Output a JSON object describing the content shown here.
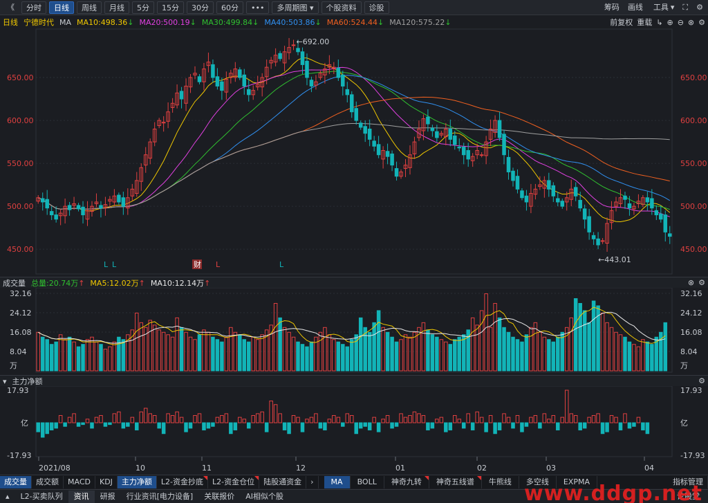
{
  "toolbar": {
    "back": "《",
    "periods": [
      "分时",
      "日线",
      "周线",
      "月线",
      "5分",
      "15分",
      "30分",
      "60分"
    ],
    "active_period": "日线",
    "more": "•••",
    "multi_period": "多周期图",
    "stock_info": "个股资料",
    "diagnose": "诊股",
    "right": [
      "筹码",
      "画线",
      "工具"
    ]
  },
  "main_legend": {
    "period": "日线",
    "stock": "宁德时代",
    "ma_label": "MA",
    "items": [
      {
        "label": "MA10:498.36",
        "dir": "↓",
        "color": "#f0c800"
      },
      {
        "label": "MA20:500.19",
        "dir": "↓",
        "color": "#e040e0"
      },
      {
        "label": "MA30:499.84",
        "dir": "↓",
        "color": "#30c030"
      },
      {
        "label": "MA40:503.86",
        "dir": "↓",
        "color": "#3090f0"
      },
      {
        "label": "MA60:524.44",
        "dir": "↓",
        "color": "#f06020"
      },
      {
        "label": "MA120:575.22",
        "dir": "↓",
        "color": "#a0a0a0"
      }
    ],
    "adjust": "前复权",
    "overlay": "重载"
  },
  "price_axis": [
    "650.00",
    "600.00",
    "550.00",
    "500.00",
    "450.00"
  ],
  "annotations": {
    "high": "692.00",
    "low": "443.01",
    "markers": [
      "L",
      "L",
      "财",
      "L",
      "L"
    ]
  },
  "volume_legend": {
    "title": "成交量",
    "total": "总量:20.74万",
    "ma5": "MA5:12.02万",
    "ma10": "MA10:12.14万",
    "arrow": "↑"
  },
  "volume_axis": [
    "32.16",
    "24.12",
    "16.08",
    "8.04",
    "万"
  ],
  "flow_legend": {
    "title": "主力净额"
  },
  "flow_axis": [
    "17.93",
    "亿",
    "-17.93"
  ],
  "x_axis": [
    "2021/08",
    "10",
    "11",
    "12",
    "01",
    "02",
    "03",
    "04"
  ],
  "indicator_tabs": [
    {
      "label": "成交量",
      "active": true
    },
    {
      "label": "成交额"
    },
    {
      "label": "MACD"
    },
    {
      "label": "KDJ"
    },
    {
      "label": "主力净额",
      "active": true
    },
    {
      "label": "L2-资金抄底",
      "flag": true
    },
    {
      "label": "L2-资金仓位",
      "flag": true
    },
    {
      "label": "陆股通资金"
    }
  ],
  "overlay_tabs": [
    {
      "label": "MA",
      "active": true
    },
    {
      "label": "BOLL"
    },
    {
      "label": "神奇九转",
      "flag": true
    },
    {
      "label": "神奇五线谱",
      "flag": true
    },
    {
      "label": "牛熊线"
    },
    {
      "label": "多空线"
    },
    {
      "label": "EXPMA"
    }
  ],
  "indicator_manage": "指标管理",
  "bottom_tabs": [
    "L2-买卖队列",
    "资讯",
    "研报",
    "行业资讯[电力设备]",
    "关联报价",
    "AI相似个股"
  ],
  "bottom_active": "资讯",
  "forum": "论股堂",
  "watermark": "www.ddgp.net",
  "colors": {
    "up": "#e04040",
    "down": "#12b4b8",
    "ma5": "#f0c800",
    "ma10vol": "#e8e8e8"
  },
  "chart_data": {
    "type": "candlestick",
    "ylim": [
      430,
      700
    ],
    "closes": [
      510,
      505,
      498,
      490,
      485,
      492,
      500,
      496,
      503,
      497,
      490,
      495,
      500,
      505,
      498,
      502,
      508,
      512,
      505,
      500,
      510,
      520,
      530,
      545,
      560,
      575,
      590,
      600,
      598,
      610,
      620,
      632,
      625,
      640,
      650,
      655,
      645,
      660,
      668,
      650,
      640,
      635,
      648,
      655,
      660,
      650,
      640,
      630,
      635,
      642,
      650,
      662,
      670,
      676,
      672,
      680,
      685,
      688,
      680,
      665,
      650,
      640,
      645,
      655,
      660,
      665,
      662,
      650,
      640,
      630,
      610,
      600,
      592,
      585,
      578,
      570,
      560,
      565,
      558,
      548,
      535,
      540,
      548,
      560,
      575,
      590,
      602,
      596,
      588,
      580,
      585,
      590,
      578,
      572,
      568,
      560,
      555,
      558,
      565,
      560,
      575,
      590,
      600,
      580,
      560,
      540,
      530,
      520,
      510,
      505,
      515,
      520,
      525,
      530,
      520,
      512,
      505,
      500,
      510,
      520,
      512,
      498,
      485,
      470,
      462,
      455,
      460,
      480,
      495,
      505,
      510,
      508,
      498,
      500,
      506,
      510,
      505,
      498,
      490,
      485,
      470,
      465
    ],
    "volumes": [
      16,
      14,
      13,
      11,
      12,
      15,
      13,
      14,
      12,
      10,
      11,
      13,
      14,
      12,
      11,
      9,
      10,
      12,
      14,
      13,
      15,
      17,
      24,
      20,
      18,
      21,
      19,
      17,
      16,
      15,
      14,
      22,
      18,
      16,
      14,
      13,
      15,
      17,
      16,
      14,
      13,
      12,
      14,
      18,
      16,
      15,
      13,
      12,
      14,
      13,
      15,
      17,
      19,
      28,
      22,
      18,
      16,
      14,
      12,
      11,
      10,
      12,
      14,
      16,
      18,
      15,
      13,
      12,
      11,
      10,
      13,
      15,
      22,
      18,
      16,
      20,
      25,
      18,
      16,
      14,
      12,
      13,
      15,
      14,
      16,
      18,
      20,
      17,
      15,
      14,
      13,
      12,
      11,
      13,
      14,
      15,
      17,
      22,
      19,
      25,
      32,
      18,
      28,
      22,
      18,
      16,
      14,
      13,
      12,
      15,
      18,
      20,
      16,
      14,
      13,
      12,
      14,
      16,
      18,
      22,
      30,
      28,
      25,
      20,
      29,
      27,
      24,
      20,
      18,
      16,
      15,
      14,
      12,
      11,
      10,
      13,
      12,
      11,
      14,
      16,
      20
    ],
    "flows": [
      -5,
      -8,
      -6,
      -4,
      -3,
      4,
      -2,
      3,
      5,
      -2,
      -1,
      2,
      -3,
      3,
      4,
      -2,
      -1,
      5,
      6,
      -3,
      -2,
      3,
      -4,
      6,
      8,
      5,
      4,
      -3,
      -6,
      5,
      4,
      6,
      3,
      -5,
      -3,
      4,
      5,
      -4,
      -3,
      -2,
      3,
      4,
      5,
      -6,
      -4,
      3,
      2,
      -3,
      4,
      5,
      6,
      -5,
      12,
      10,
      5,
      -4,
      -6,
      4,
      3,
      -5,
      2,
      3,
      5,
      -3,
      -4,
      2,
      4,
      3,
      -2,
      5,
      4,
      -6,
      -3,
      -2,
      -4,
      3,
      -5,
      2,
      4,
      -3,
      -2,
      5,
      3,
      4,
      6,
      5,
      4,
      -4,
      -3,
      2,
      3,
      -5,
      -4,
      4,
      2,
      -3,
      5,
      -4,
      6,
      3,
      -5,
      4,
      -6,
      -4,
      5,
      3,
      -3,
      4,
      -5,
      -2,
      3,
      4,
      -3,
      5,
      2,
      4,
      -4,
      3,
      17.93,
      5,
      4,
      -4,
      -3,
      3,
      4,
      5,
      -6,
      -5,
      4,
      3,
      -4,
      5,
      -3,
      -2,
      3,
      -4,
      -6
    ]
  }
}
